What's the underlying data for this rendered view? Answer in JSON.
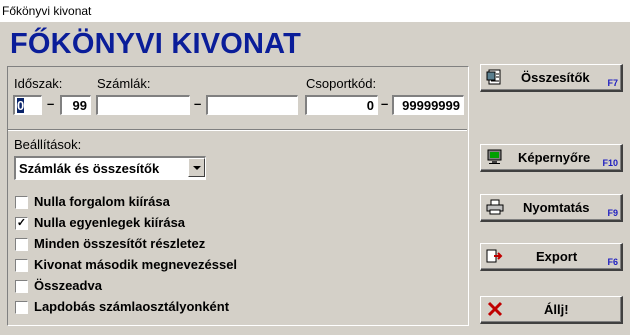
{
  "window": {
    "title": "Főkönyvi kivonat"
  },
  "header": {
    "title": "FŐKÖNYVI KIVONAT"
  },
  "filters": {
    "idoszak_label": "Időszak:",
    "szamlak_label": "Számlák:",
    "csoportkod_label": "Csoportkód:",
    "idoszak_from": "0",
    "idoszak_to": "99",
    "szamlak_from": "",
    "szamlak_to": "",
    "csoportkod_from": "0",
    "csoportkod_to": "99999999",
    "dash": "–"
  },
  "settings": {
    "label": "Beállítások:",
    "selected": "Számlák és összesítők"
  },
  "options": [
    {
      "label": "Nulla forgalom kiírása",
      "checked": false
    },
    {
      "label": "Nulla egyenlegek kiírása",
      "checked": true
    },
    {
      "label": "Minden összesítőt részletez",
      "checked": false
    },
    {
      "label": "Kivonat második megnevezéssel",
      "checked": false
    },
    {
      "label": "Összeadva",
      "checked": false
    },
    {
      "label": "Lapdobás számlaosztályonként",
      "checked": false
    }
  ],
  "buttons": {
    "osszesitok": {
      "label": "Összesítők",
      "key": "F7"
    },
    "kepernyore": {
      "label": "Képernyőre",
      "key": "F10"
    },
    "nyomtatas": {
      "label": "Nyomtatás",
      "key": "F9"
    },
    "export": {
      "label": "Export",
      "key": "F6"
    },
    "allj": {
      "label": "Állj!"
    }
  },
  "colors": {
    "title_blue": "#0a1d99",
    "face": "#d4d0c8",
    "hotkey_blue": "#1d1dc0",
    "stop_red": "#c00000"
  }
}
